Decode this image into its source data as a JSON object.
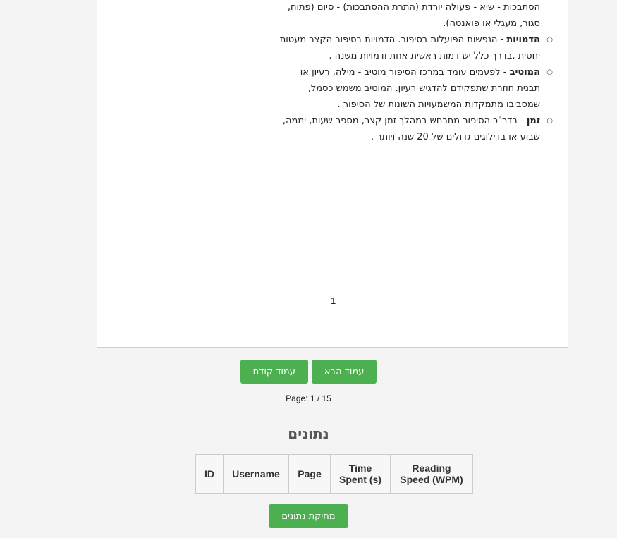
{
  "document": {
    "lines": [
      {
        "type": "plain",
        "text": "הסתבכות - שיא - פעולה יורדת (התרת ההסתבכות) - סיום (פתוח,"
      },
      {
        "type": "plain",
        "text": "סגור, מעגלי או פואנטה)."
      }
    ],
    "items": [
      {
        "bold": "הדמויות",
        "rest": " - הנפשות הפועלות בסיפור. הדמויות בסיפור הקצר מעטות",
        "more": [
          "יחסית .בדרך כלל יש דמות ראשית אחת ודמויות משנה ."
        ]
      },
      {
        "bold": "המוטיב",
        "rest": " - לפעמים עומד במרכז הסיפור מוטיב - מילה, רעיון או",
        "more": [
          "תבנית חוזרת שתפקידם להדגיש רעיון. המוטיב משמש כסמל,",
          "שמסביבו מתמקדות המשמעויות השונות של הסיפור ."
        ]
      },
      {
        "bold": "זמן",
        "rest": " - בדר\"כ הסיפור מתרחש במהלך זמן קצר, מספר שעות, יממה,",
        "more": [
          "שבוע או בדילוגים גדולים של 20 שנה ויותר ."
        ]
      }
    ],
    "page_number": "1"
  },
  "nav": {
    "next_label": "עמוד הבא",
    "prev_label": "עמוד קודם",
    "page_info": "Page: 1 / 15"
  },
  "data_section": {
    "heading": "נתונים",
    "columns": [
      "ID",
      "Username",
      "Page",
      "Time Spent (s)",
      "Reading Speed (WPM)"
    ],
    "clear_label": "מחיקת נתונים"
  },
  "colors": {
    "button": "#4caf50"
  }
}
